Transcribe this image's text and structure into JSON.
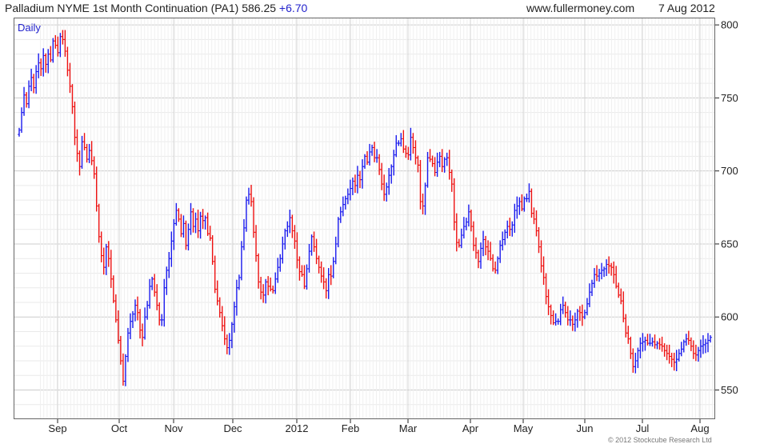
{
  "header": {
    "instrument": "Palladium NYME 1st Month Continuation (PA1) 586.25",
    "change": "+6.70",
    "site": "www.fullermoney.com",
    "date": "7 Aug 2012"
  },
  "footer": {
    "copyright": "© 2012 Stockcube Research Ltd"
  },
  "colors": {
    "up": "#1a1aee",
    "down": "#ee1111",
    "grid": "#dddddd",
    "axis": "#222222"
  },
  "chart_data": {
    "type": "ohlc",
    "period_label": "Daily",
    "y_ticks": [
      550,
      600,
      650,
      700,
      750,
      800
    ],
    "x_labels": [
      "Sep",
      "Oct",
      "Nov",
      "Dec",
      "2012",
      "Feb",
      "Mar",
      "Apr",
      "May",
      "Jun",
      "Jul",
      "Aug"
    ],
    "ylim": [
      530,
      805
    ],
    "grid": true,
    "series": [
      {
        "values": [
          728,
          740,
          752,
          746,
          758,
          764,
          757,
          768,
          774,
          770,
          779,
          773,
          780,
          776,
          789,
          786,
          781,
          792,
          790,
          782,
          769,
          758,
          744,
          723,
          712,
          703,
          720,
          716,
          708,
          714,
          707,
          698,
          676,
          655,
          642,
          634,
          648,
          640,
          626,
          611,
          598,
          584,
          570,
          556,
          573,
          589,
          597,
          602,
          608,
          603,
          591,
          586,
          600,
          608,
          621,
          626,
          617,
          608,
          598,
          598,
          620,
          632,
          640,
          652,
          664,
          673,
          667,
          657,
          664,
          649,
          660,
          672,
          662,
          667,
          659,
          669,
          666,
          668,
          657,
          654,
          638,
          619,
          611,
          603,
          594,
          585,
          579,
          584,
          595,
          607,
          620,
          627,
          648,
          661,
          680,
          684,
          679,
          658,
          642,
          624,
          617,
          615,
          624,
          621,
          619,
          618,
          626,
          634,
          640,
          650,
          659,
          662,
          668,
          659,
          652,
          639,
          631,
          629,
          621,
          633,
          645,
          655,
          648,
          640,
          634,
          628,
          624,
          618,
          629,
          628,
          638,
          650,
          667,
          672,
          677,
          681,
          684,
          688,
          693,
          690,
          697,
          694,
          703,
          710,
          706,
          713,
          716,
          709,
          709,
          701,
          691,
          684,
          689,
          697,
          703,
          711,
          719,
          719,
          722,
          715,
          712,
          711,
          723,
          716,
          709,
          704,
          679,
          676,
          690,
          709,
          708,
          705,
          699,
          706,
          710,
          703,
          708,
          709,
          699,
          691,
          665,
          651,
          649,
          656,
          662,
          665,
          672,
          662,
          649,
          644,
          638,
          647,
          653,
          648,
          645,
          640,
          633,
          632,
          640,
          649,
          653,
          658,
          662,
          660,
          663,
          673,
          676,
          679,
          674,
          681,
          681,
          686,
          671,
          667,
          659,
          648,
          635,
          627,
          614,
          607,
          601,
          596,
          597,
          597,
          605,
          608,
          603,
          598,
          598,
          595,
          598,
          604,
          603,
          600,
          603,
          609,
          617,
          623,
          629,
          628,
          630,
          632,
          633,
          636,
          635,
          634,
          629,
          621,
          615,
          611,
          599,
          589,
          585,
          575,
          566,
          570,
          577,
          582,
          583,
          584,
          582,
          582,
          583,
          581,
          582,
          581,
          580,
          577,
          575,
          573,
          571,
          569,
          571,
          575,
          578,
          583,
          585,
          584,
          580,
          575,
          574,
          577,
          580,
          581,
          582,
          584,
          586
        ]
      }
    ]
  }
}
